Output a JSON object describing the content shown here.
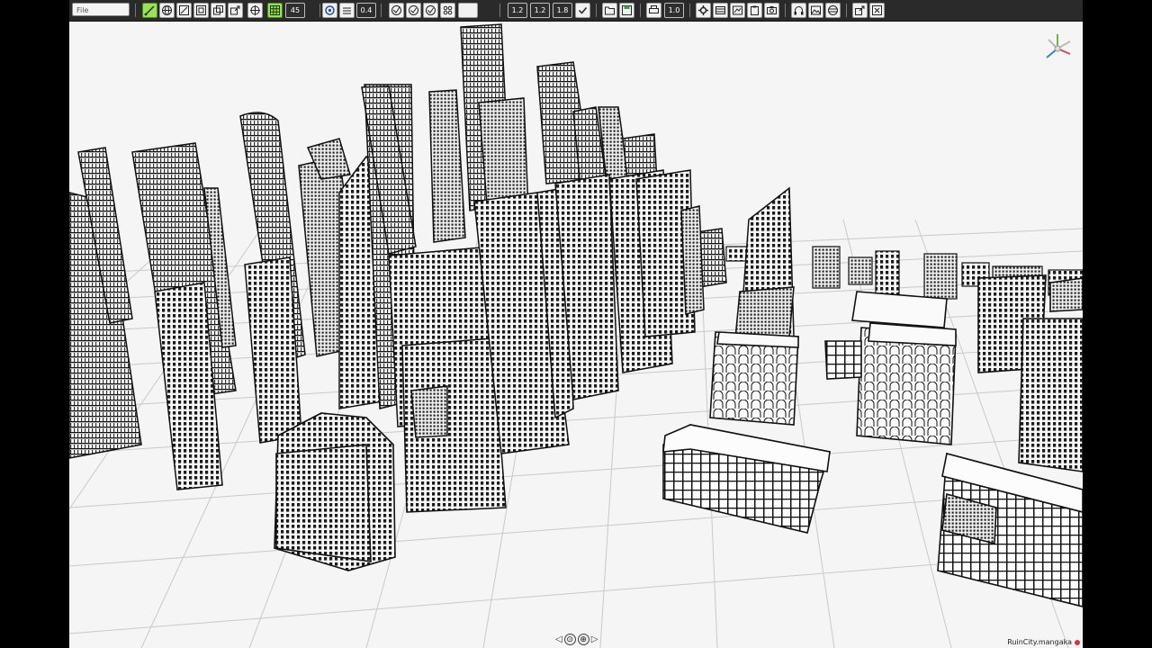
{
  "toolbar": {
    "file_placeholder": "File",
    "angle_value": "45",
    "line_width": "0.4",
    "scale_a": "1.2",
    "scale_b": "1.2",
    "scale_c": "1.8",
    "opacity": "1.0"
  },
  "status": {
    "file_name": "RuinCity.mangaka"
  },
  "nav": {
    "left_arrow": "◁",
    "right_arrow": "▷",
    "center_symbol": "⊙",
    "zoom_symbol": "⊕"
  },
  "gizmo": {
    "y_label": "y",
    "x_label": "x",
    "z_label": "z"
  },
  "colors": {
    "toolbar_bg": "#2a2a2a",
    "accent_green": "#9be05a",
    "viewport_bg": "#f5f5f5",
    "status_dot": "#dd3333"
  }
}
